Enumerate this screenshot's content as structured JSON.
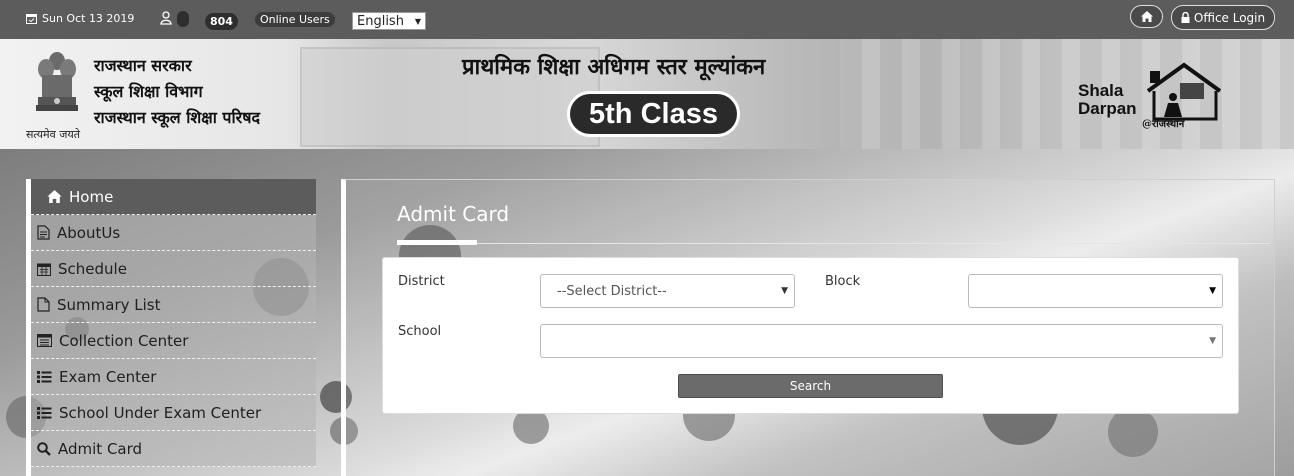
{
  "topbar": {
    "date": "Sun Oct 13 2019",
    "online_count": "804",
    "online_label": "Online Users",
    "language": "English",
    "office_login": "Office Login"
  },
  "banner": {
    "govt_line1": "राजस्थान सरकार",
    "govt_line2": "स्कूल शिक्षा विभाग",
    "govt_line3": "राजस्थान स्कूल शिक्षा परिषद",
    "emblem_motto": "सत्यमेव जयते",
    "title": "प्राथमिक शिक्षा अधिगम स्तर मूल्यांकन",
    "class_label": "5th Class",
    "logo_line1": "Shala",
    "logo_line2": "Darpan",
    "logo_tag": "@राजस्थान"
  },
  "sidebar": {
    "items": [
      {
        "label": "Home",
        "icon": "home-icon"
      },
      {
        "label": "AboutUs",
        "icon": "file-text-icon"
      },
      {
        "label": "Schedule",
        "icon": "calendar-icon"
      },
      {
        "label": "Summary List",
        "icon": "file-icon"
      },
      {
        "label": "Collection Center",
        "icon": "list-alt-icon"
      },
      {
        "label": "Exam Center",
        "icon": "list-icon"
      },
      {
        "label": "School Under Exam Center",
        "icon": "list-icon"
      },
      {
        "label": "Admit Card",
        "icon": "search-icon"
      }
    ]
  },
  "main": {
    "title": "Admit Card",
    "form": {
      "district_label": "District",
      "district_value": "--Select District--",
      "block_label": "Block",
      "block_value": "",
      "school_label": "School",
      "school_value": "",
      "search_button": "Search"
    }
  },
  "colors": {
    "topbar": "#5c5c5c",
    "sidebar_active": "#5c5c5c",
    "button": "#6b6b6b"
  }
}
